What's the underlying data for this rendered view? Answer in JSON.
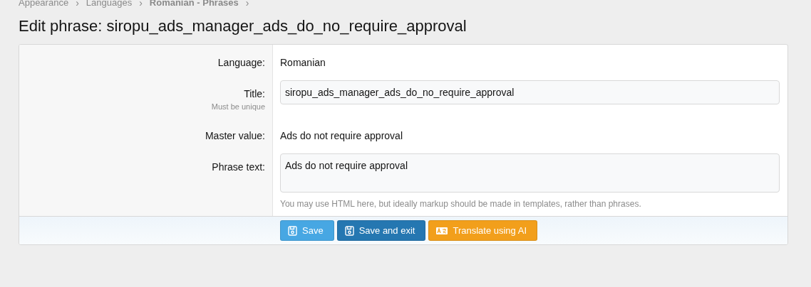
{
  "breadcrumb": [
    {
      "label": "Appearance",
      "current": false
    },
    {
      "label": "Languages",
      "current": false
    },
    {
      "label": "Romanian - Phrases",
      "current": true
    }
  ],
  "breadcrumb_separator": "›",
  "page_title": "Edit phrase: siropu_ads_manager_ads_do_no_require_approval",
  "rows": [
    {
      "kind": "text",
      "label": "Language:",
      "value": "Romanian"
    },
    {
      "kind": "input",
      "label": "Title:",
      "hint": "Must be unique",
      "value": "siropu_ads_manager_ads_do_no_require_approval"
    },
    {
      "kind": "text",
      "label": "Master value:",
      "value": "Ads do not require approval"
    },
    {
      "kind": "textarea",
      "label": "Phrase text:",
      "value": "Ads do not require approval",
      "explain": "You may use HTML here, but ideally markup should be made in templates, rather than phrases."
    }
  ],
  "buttons": [
    {
      "label": "Save",
      "kind": "primary"
    },
    {
      "label": "Save and exit",
      "kind": "dark"
    },
    {
      "label": "Translate using AI",
      "kind": "accent"
    }
  ]
}
